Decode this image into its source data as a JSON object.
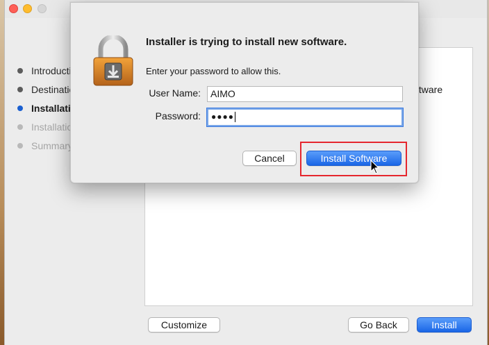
{
  "steps": [
    {
      "label": "Introduction",
      "state": "done"
    },
    {
      "label": "Destination Select",
      "state": "done"
    },
    {
      "label": "Installation Type",
      "state": "current"
    },
    {
      "label": "Installation",
      "state": "todo"
    },
    {
      "label": "Summary",
      "state": "todo"
    }
  ],
  "pane": {
    "text_fragment": "ftware"
  },
  "footer": {
    "customize_label": "Customize",
    "goback_label": "Go Back",
    "install_label": "Install"
  },
  "dialog": {
    "title": "Installer is trying to install new software.",
    "message": "Enter your password to allow this.",
    "username_label": "User Name:",
    "username_value": "AIMO",
    "password_label": "Password:",
    "password_masked": "●●●●",
    "cancel_label": "Cancel",
    "install_software_label": "Install Software",
    "lock_icon": "padlock-download-icon"
  },
  "colors": {
    "accent": "#1a66e6",
    "highlight_box": "#e5262d"
  }
}
